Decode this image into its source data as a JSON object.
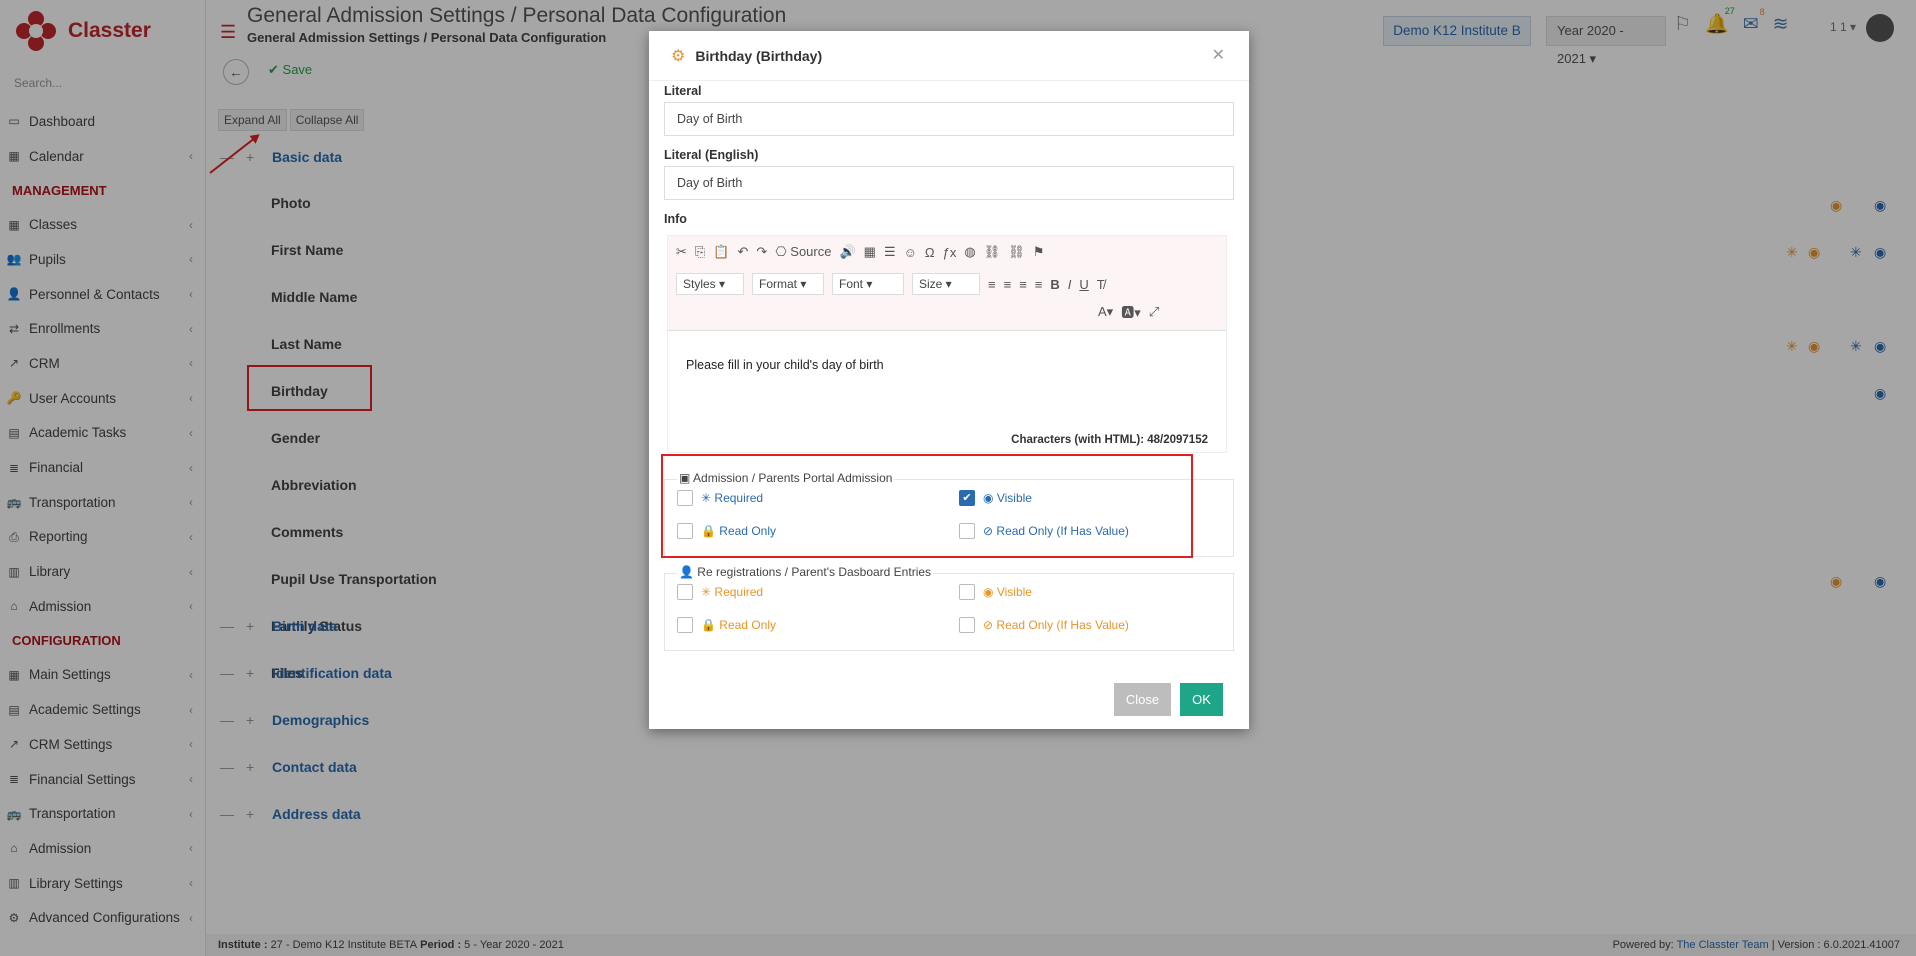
{
  "app": {
    "logo_text": "Classter",
    "search_placeholder": "Search..."
  },
  "sidebar": {
    "items_top": [
      {
        "label": "Dashboard",
        "icon": "monitor-icon",
        "chevron": false
      },
      {
        "label": "Calendar",
        "icon": "calendar-icon",
        "chevron": true
      }
    ],
    "management_heading": "MANAGEMENT",
    "management": [
      {
        "label": "Classes",
        "icon": "grid-icon"
      },
      {
        "label": "Pupils",
        "icon": "users-icon"
      },
      {
        "label": "Personnel & Contacts",
        "icon": "contacts-icon"
      },
      {
        "label": "Enrollments",
        "icon": "exchange-icon"
      },
      {
        "label": "CRM",
        "icon": "crm-icon"
      },
      {
        "label": "User Accounts",
        "icon": "key-icon"
      },
      {
        "label": "Academic Tasks",
        "icon": "table-icon"
      },
      {
        "label": "Financial",
        "icon": "stack-icon"
      },
      {
        "label": "Transportation",
        "icon": "bus-icon"
      },
      {
        "label": "Reporting",
        "icon": "print-icon"
      },
      {
        "label": "Library",
        "icon": "books-icon"
      },
      {
        "label": "Admission",
        "icon": "bank-icon"
      }
    ],
    "configuration_heading": "CONFIGURATION",
    "configuration": [
      {
        "label": "Main Settings",
        "icon": "grid-icon"
      },
      {
        "label": "Academic Settings",
        "icon": "table-icon"
      },
      {
        "label": "CRM Settings",
        "icon": "crm-icon"
      },
      {
        "label": "Financial Settings",
        "icon": "stack-icon"
      },
      {
        "label": "Transportation",
        "icon": "bus-icon"
      },
      {
        "label": "Admission",
        "icon": "bank-icon"
      },
      {
        "label": "Library Settings",
        "icon": "books-icon"
      },
      {
        "label": "Advanced Configurations",
        "icon": "gears-icon"
      }
    ]
  },
  "header": {
    "title": "General Admission Settings / Personal Data Configuration",
    "subtitle": "General Admission Settings / Personal Data Configuration",
    "save_label": "Save",
    "institute": "Demo K12 Institute B",
    "year": "Year 2020 - 2021",
    "notif_count": "27",
    "mail_count": "8",
    "user_short": "1 1"
  },
  "content": {
    "expand_all": "Expand All",
    "collapse_all": "Collapse All",
    "sections": {
      "basic": "Basic data",
      "birth": "Birth data",
      "identification": "Identification data",
      "demographics": "Demographics",
      "contact": "Contact data",
      "address": "Address data"
    },
    "fields": [
      "Photo",
      "First Name",
      "Middle Name",
      "Last Name",
      "Birthday",
      "Gender",
      "Abbreviation",
      "Comments",
      "Pupil Use Transportation",
      "Family Status",
      "Files"
    ]
  },
  "footer": {
    "institute_label": "Institute :",
    "institute_value": "27 - Demo K12 Institute BETA",
    "period_label": "Period :",
    "period_value": "5 - Year 2020 - 2021",
    "powered_by": "Powered by:",
    "powered_link": "The Classter Team",
    "version": "| Version : 6.0.2021.41007"
  },
  "modal": {
    "title": "Birthday (Birthday)",
    "literal_label": "Literal",
    "literal_value": "Day of Birth",
    "literal_en_label": "Literal (English)",
    "literal_en_value": "Day of Birth",
    "info_label": "Info",
    "toolbar": {
      "source": "Source",
      "styles": "Styles",
      "format": "Format",
      "font": "Font",
      "size": "Size"
    },
    "editor_text": "Please fill in your child's day of birth",
    "char_count": "Characters (with HTML): 48/2097152",
    "admission_legend": "Admission / Parents Portal Admission",
    "rereg_legend": "Re registrations / Parent's Dasboard Entries",
    "opt_required": "Required",
    "opt_visible": "Visible",
    "opt_readonly": "Read Only",
    "opt_readonly_value": "Read Only (If Has Value)",
    "admission_visible_checked": true,
    "close_label": "Close",
    "ok_label": "OK"
  }
}
